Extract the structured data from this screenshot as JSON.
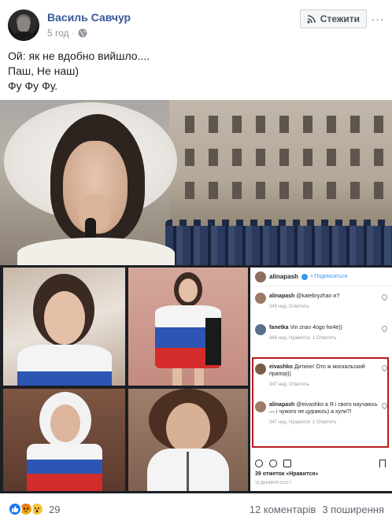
{
  "post": {
    "author": "Василь Савчур",
    "time": "5 год",
    "follow_label": "Стежити",
    "text_lines": [
      "Ой: як не вдобно вийшло....",
      "Паш, Не наш)",
      "Фу Фу Фу."
    ]
  },
  "instagram": {
    "username": "alinapash",
    "subscribe_label": "• Подписаться",
    "comments": [
      {
        "user": "alinapash",
        "text": "@katebryzhan и?",
        "meta": "349 нед.   Ответить"
      },
      {
        "user": "fanetka",
        "text": "Vin znav 4ogo ho4e))",
        "meta": "349 нед.   Нравится: 1   Ответить"
      },
      {
        "user": "eivashko",
        "text": "Дитино! Ото ж москальский прапор))",
        "meta": "347 нед.   Ответить"
      },
      {
        "user": "alinapash",
        "text": "@eivashko а Я і свого научаюсь — і чужого не цураюсь) а хули?!",
        "meta": "347 нед.   Нравится: 1   Ответить"
      }
    ],
    "likes": "39 отметок «Нравится»",
    "date": "15 ДЕКАБРЯ 2012 Г."
  },
  "footer": {
    "reaction_count": "29",
    "comments": "12 коментарів",
    "shares": "3 поширення"
  },
  "icons": {
    "follow": "rss-icon",
    "privacy": "globe-icon",
    "reactions": [
      "like-icon",
      "angry-icon",
      "wow-icon"
    ]
  },
  "colors": {
    "author_link": "#385898",
    "meta": "#90949c",
    "like": "#1877f2",
    "highlight": "#b71c1c"
  }
}
